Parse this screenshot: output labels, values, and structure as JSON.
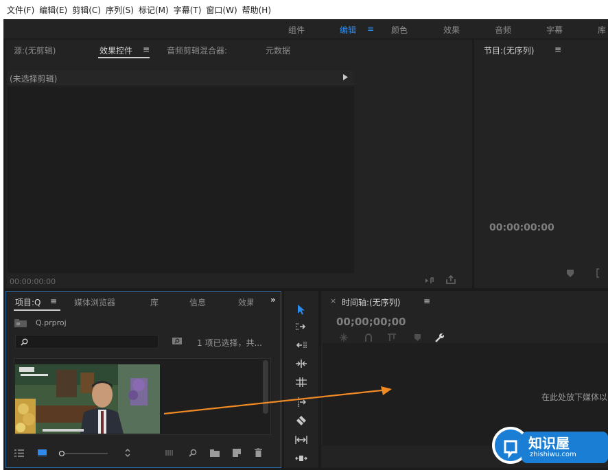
{
  "menu": [
    "文件(F)",
    "编辑(E)",
    "剪辑(C)",
    "序列(S)",
    "标记(M)",
    "字幕(T)",
    "窗口(W)",
    "帮助(H)"
  ],
  "workspace_tabs": [
    {
      "label": "组件"
    },
    {
      "label": "编辑"
    },
    {
      "label": "≡"
    },
    {
      "label": "颜色"
    },
    {
      "label": "效果"
    },
    {
      "label": "音频"
    },
    {
      "label": "字幕"
    },
    {
      "label": "库"
    }
  ],
  "source_panel": {
    "tabs": [
      "源:(无剪辑)",
      "效果控件",
      "≡",
      "音频剪辑混合器:",
      "元数据"
    ],
    "clip_header": "(未选择剪辑)",
    "timecode": "00:00:00:00"
  },
  "program_panel": {
    "title": "节目:(无序列)",
    "menu_icon": "≡",
    "timecode": "00:00:00:00"
  },
  "project_panel": {
    "tabs": [
      "项目:Q",
      "≡",
      "媒体浏览器",
      "库",
      "信息",
      "效果"
    ],
    "overflow": "»",
    "project_file": "Q.prproj",
    "selection_info": "1 项已选择，共..."
  },
  "timeline_panel": {
    "close": "×",
    "title": "时间轴:(无序列)",
    "menu_icon": "≡",
    "timecode": "00;00;00;00",
    "drop_hint": "在此处放下媒体以"
  },
  "watermark": {
    "name": "知识屋",
    "url": "zhishiwu.com"
  },
  "colors": {
    "accent": "#2d8ceb",
    "arrow": "#f08a24",
    "watermark_blue": "#1a7fd4"
  }
}
